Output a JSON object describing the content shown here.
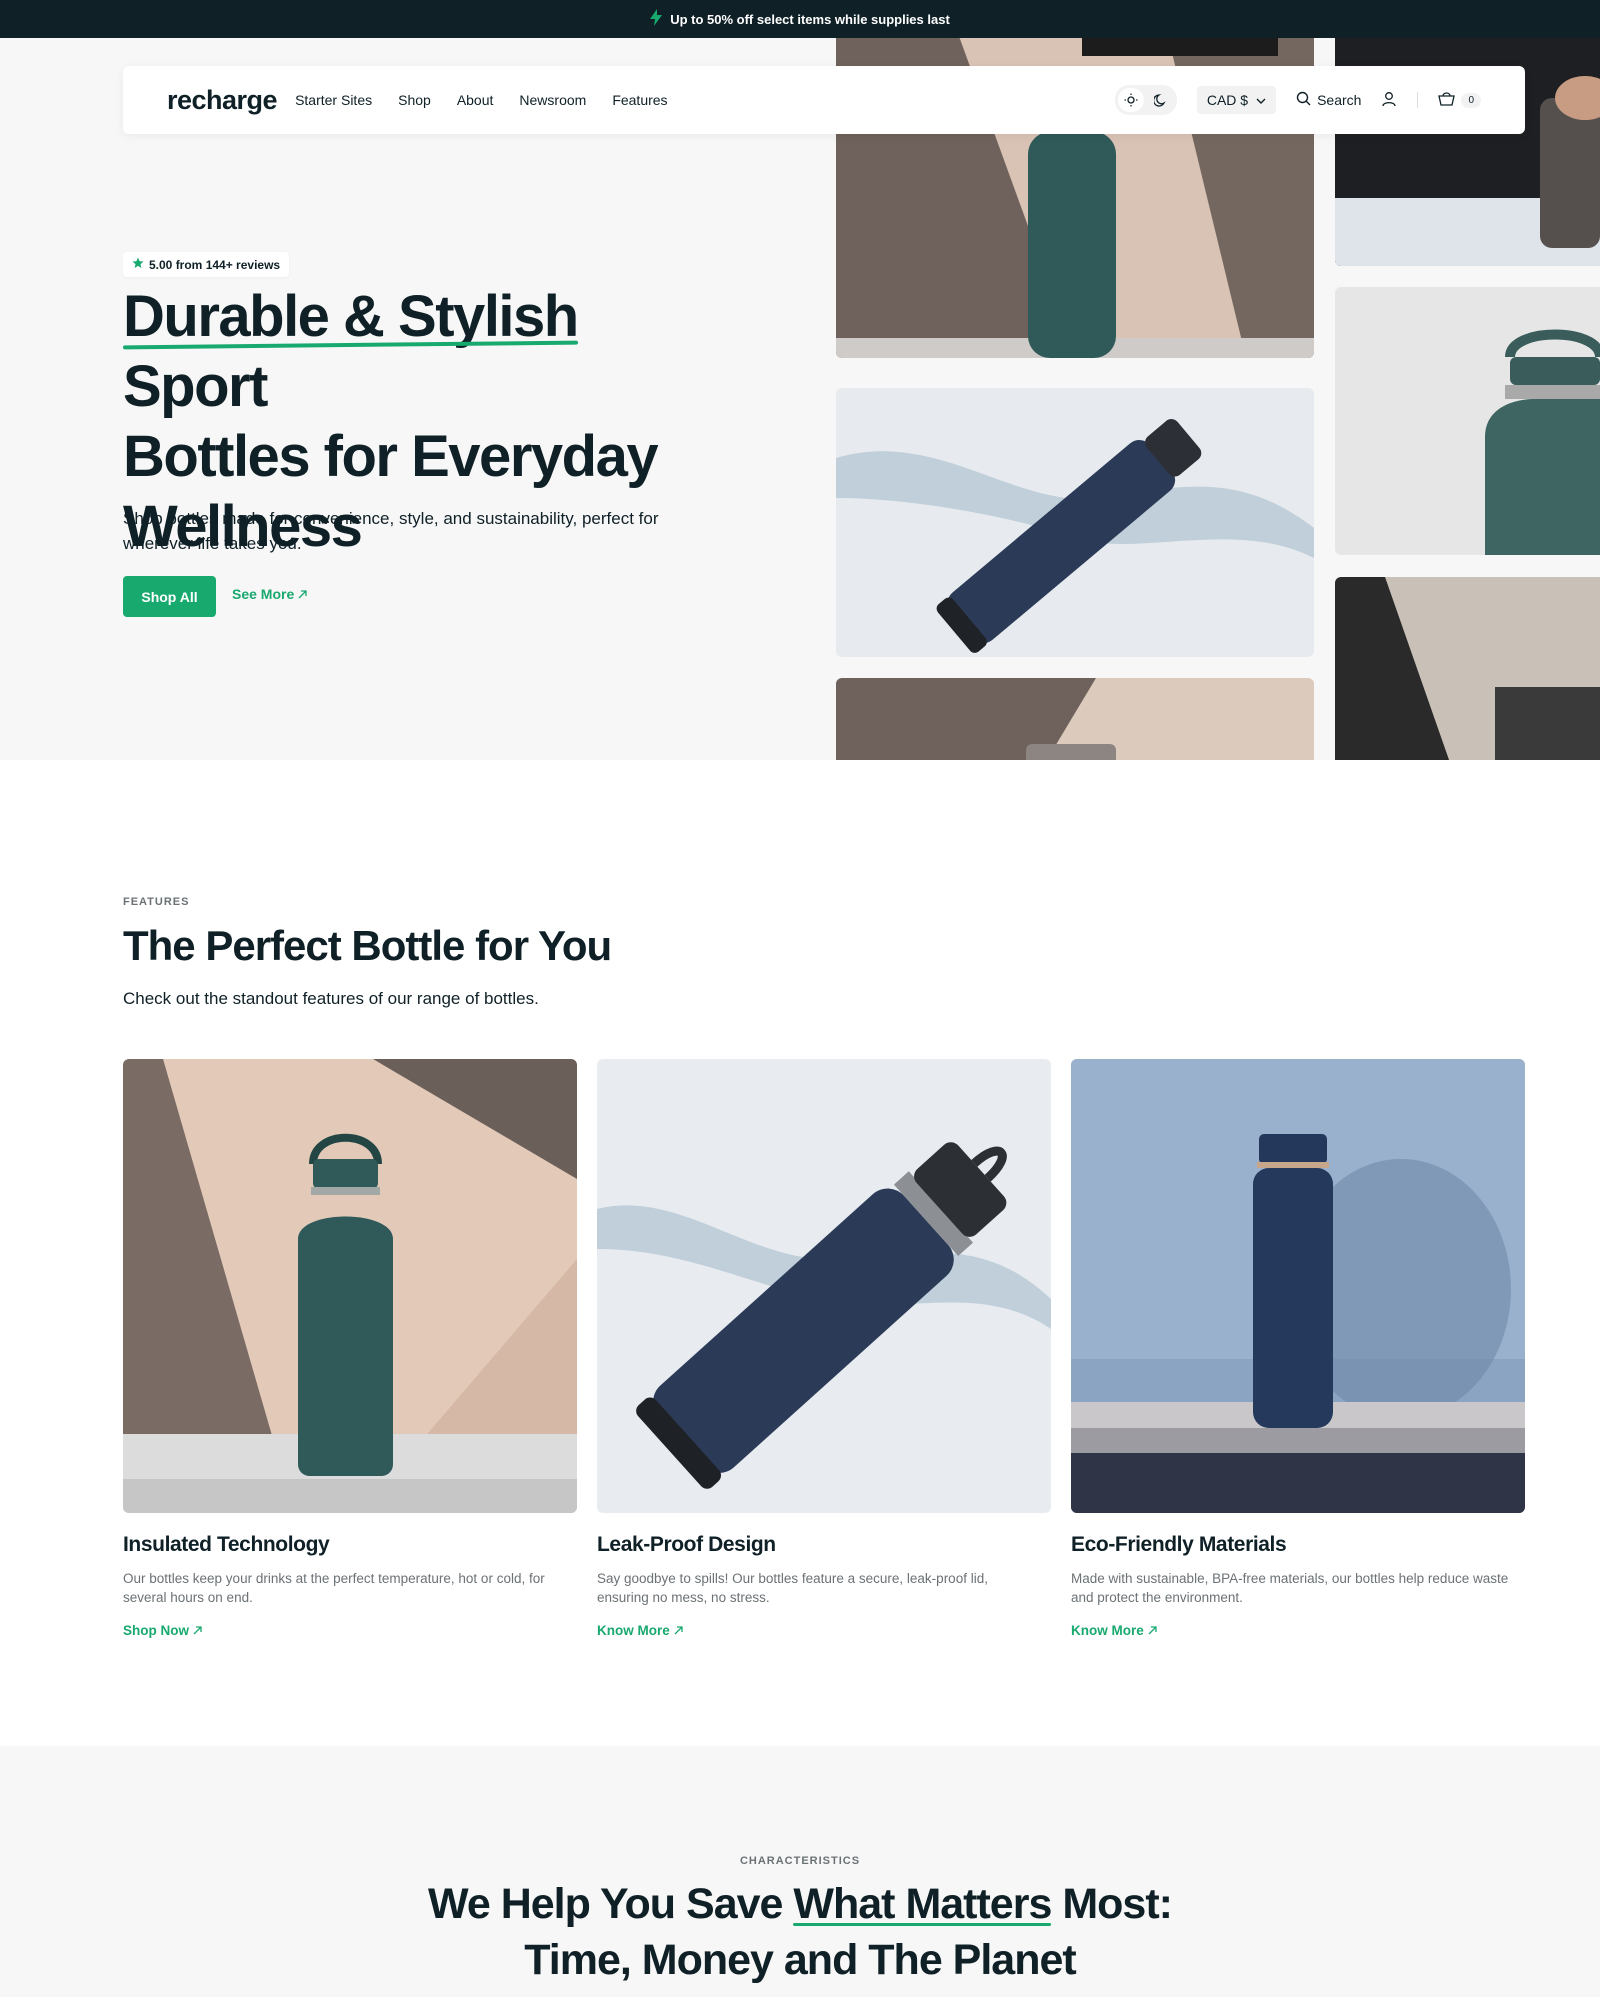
{
  "announcement": {
    "text": "Up to 50% off select items while supplies last"
  },
  "nav": {
    "logo": "recharge",
    "links": [
      "Starter Sites",
      "Shop",
      "About",
      "Newsroom",
      "Features"
    ],
    "currency": "CAD $",
    "search_label": "Search",
    "cart_count": "0"
  },
  "hero": {
    "rating": "5.00 from 144+ reviews",
    "title_underlined": "Durable & Stylish",
    "title_rest_line1": " Sport",
    "title_line2": "Bottles for Everyday",
    "title_line3": "Wellness",
    "subtitle": "Shop bottles made for convenience, style, and sustainability, perfect for wherever life takes you.",
    "primary_button": "Shop All",
    "secondary_link": "See More"
  },
  "features": {
    "eyebrow": "FEATURES",
    "title": "The Perfect Bottle for You",
    "subtitle": "Check out the standout features of our range of bottles.",
    "cards": [
      {
        "title": "Insulated Technology",
        "text": "Our bottles keep your drinks at the perfect temperature, hot or cold, for several hours on end.",
        "link": "Shop Now"
      },
      {
        "title": "Leak-Proof Design",
        "text": "Say goodbye to spills! Our bottles feature a secure, leak-proof lid, ensuring no mess, no stress.",
        "link": "Know More"
      },
      {
        "title": "Eco-Friendly Materials",
        "text": "Made with sustainable, BPA-free materials, our bottles help reduce waste and protect the environment.",
        "link": "Know More"
      }
    ]
  },
  "characteristics": {
    "eyebrow": "CHARACTERISTICS",
    "title_prefix": "We Help You Save ",
    "title_underlined": "What Matters",
    "title_suffix": " Most:",
    "title_line2": "Time, Money and The Planet"
  },
  "colors": {
    "accent": "#18a96f",
    "dark": "#0f2027",
    "muted": "#6b7276",
    "surface": "#f7f7f7"
  },
  "icons": [
    "bolt-icon",
    "sun-icon",
    "moon-icon",
    "chevron-down-icon",
    "search-icon",
    "user-icon",
    "cart-icon",
    "star-icon",
    "arrow-up-right-icon"
  ]
}
